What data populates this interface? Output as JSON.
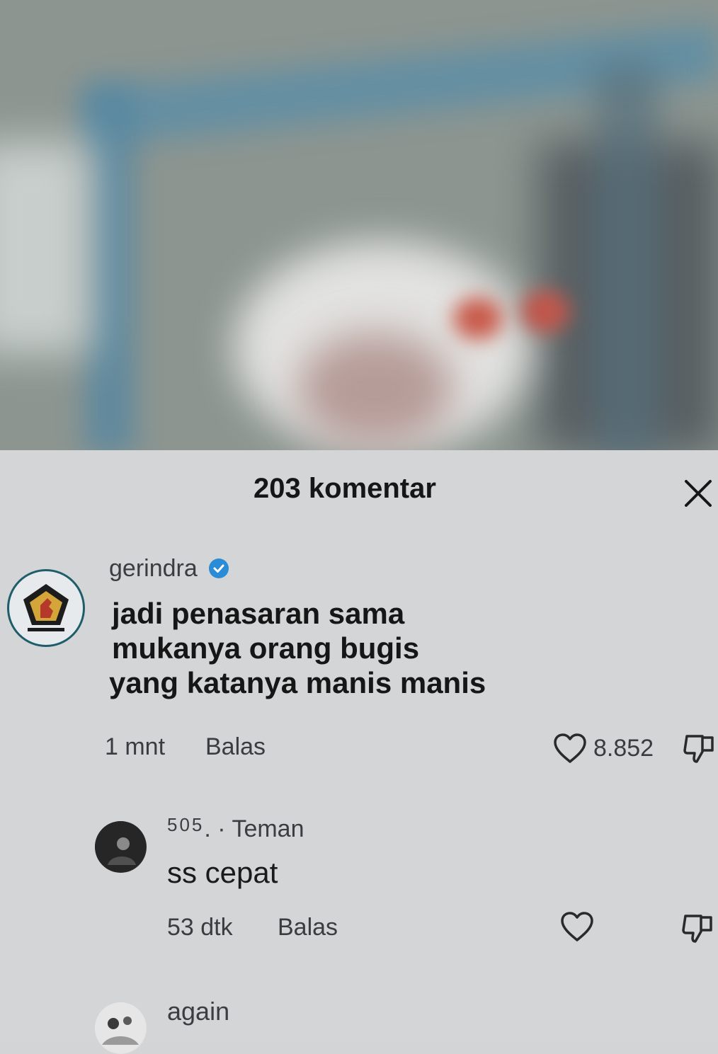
{
  "sheet": {
    "title": "203 komentar"
  },
  "comments": [
    {
      "username": "gerindra",
      "verified": true,
      "text_lines": [
        "jadi penasaran sama",
        "mukanya orang bugis",
        "yang katanya manis manis"
      ],
      "time": "1 mnt",
      "reply_label": "Balas",
      "likes": "8.852"
    },
    {
      "username_prefix": "505",
      "username": ". · Teman",
      "text_lines": [
        "ss cepat"
      ],
      "time": "53 dtk",
      "reply_label": "Balas"
    },
    {
      "username": "again"
    }
  ],
  "colors": {
    "verified": "#2a8bd6",
    "sheet_bg": "#d3d5d7",
    "text": "#161616",
    "avatar_ring": "#1f5d6a"
  },
  "icons": {
    "close": "close-icon",
    "verified": "verified-badge-icon",
    "like": "heart-icon",
    "dislike": "thumbs-down-icon"
  }
}
